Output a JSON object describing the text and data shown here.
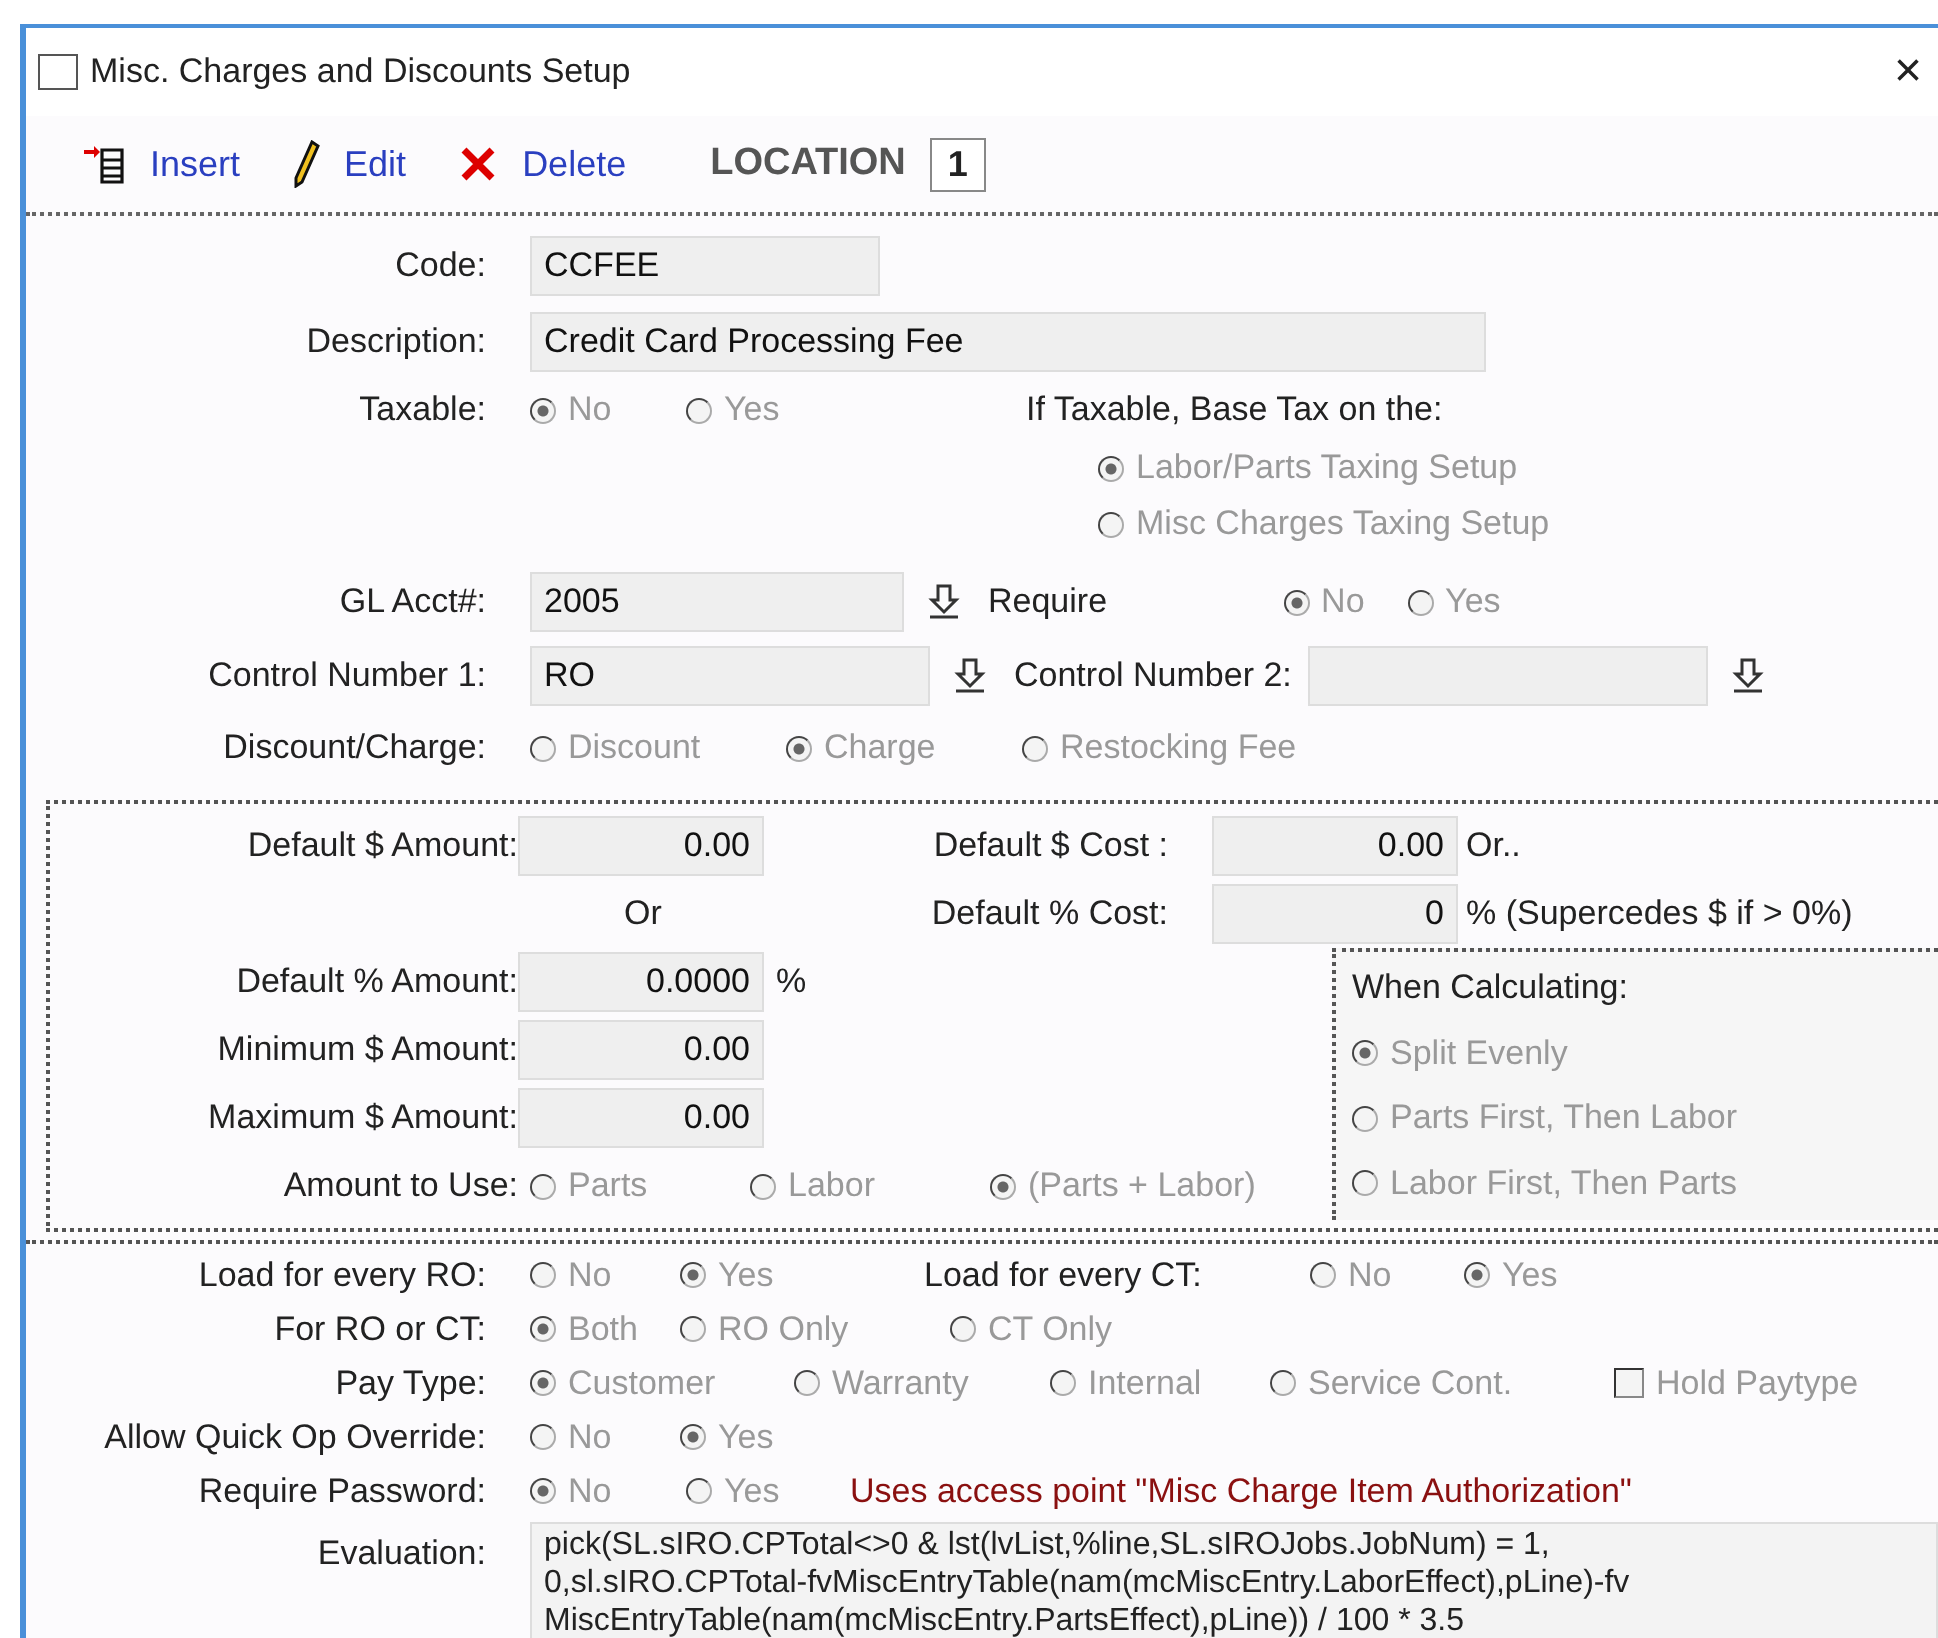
{
  "window": {
    "title": "Misc. Charges and Discounts Setup",
    "close": "×"
  },
  "toolbar": {
    "buttons": [
      {
        "kind": "insert",
        "label": "Insert"
      },
      {
        "kind": "edit",
        "label": "Edit"
      },
      {
        "kind": "delete",
        "label": "Delete"
      }
    ],
    "location_label": "LOCATION",
    "location_value": "1"
  },
  "general": {
    "code": {
      "label": "Code:",
      "value": "CCFEE"
    },
    "description": {
      "label": "Description:",
      "value": "Credit Card Processing Fee"
    },
    "taxable": {
      "label": "Taxable:",
      "options": [
        {
          "label": "No",
          "selected": true
        },
        {
          "label": "Yes",
          "selected": false
        }
      ]
    },
    "tax_base": {
      "label": "If Taxable, Base Tax on the:",
      "options": [
        {
          "label": "Labor/Parts  Taxing Setup",
          "selected": true
        },
        {
          "label": "Misc Charges Taxing Setup",
          "selected": false
        }
      ]
    },
    "gl_acct": {
      "label": "GL Acct#:",
      "value": "2005"
    },
    "require": {
      "label": "Require",
      "options": [
        {
          "label": "No",
          "selected": true
        },
        {
          "label": "Yes",
          "selected": false
        }
      ]
    },
    "control_number_1": {
      "label": "Control Number 1:",
      "value": "RO"
    },
    "control_number_2": {
      "label": "Control Number 2:"
    },
    "discount_charge": {
      "label": "Discount/Charge:",
      "options": [
        {
          "label": "Discount",
          "selected": false
        },
        {
          "label": "Charge",
          "selected": true
        },
        {
          "label": "Restocking Fee",
          "selected": false
        }
      ]
    }
  },
  "amounts": {
    "default_amount": {
      "label": "Default $ Amount:",
      "value": "0.00"
    },
    "or_text": "Or",
    "default_pct_amount": {
      "label": "Default % Amount:",
      "value": "0.0000",
      "suffix": "%"
    },
    "minimum_amount": {
      "label": "Minimum $ Amount:",
      "value": "0.00"
    },
    "maximum_amount": {
      "label": "Maximum $ Amount:",
      "value": "0.00"
    },
    "amount_to_use": {
      "label": "Amount to Use:",
      "options": [
        {
          "label": "Parts",
          "selected": false
        },
        {
          "label": "Labor",
          "selected": false
        },
        {
          "label": "(Parts + Labor)",
          "selected": true
        }
      ]
    },
    "default_cost": {
      "label": "Default $ Cost :",
      "value": "0.00",
      "suffix": "Or.."
    },
    "default_pct_cost": {
      "label": "Default % Cost:",
      "value": "0",
      "suffix": "% (Supercedes $ if > 0%)"
    },
    "when_calculating": {
      "label": "When Calculating:",
      "options": [
        {
          "label": "Split Evenly",
          "selected": true
        },
        {
          "label": "Parts First, Then Labor",
          "selected": false
        },
        {
          "label": "Labor First, Then Parts",
          "selected": false
        }
      ]
    }
  },
  "options": {
    "load_ro": {
      "label": "Load for every RO:",
      "options": [
        {
          "label": "No",
          "selected": false
        },
        {
          "label": "Yes",
          "selected": true
        }
      ]
    },
    "load_ct": {
      "label": "Load for every CT:",
      "options": [
        {
          "label": "No",
          "selected": false
        },
        {
          "label": "Yes",
          "selected": true
        }
      ]
    },
    "for_ro_ct": {
      "label": "For RO or CT:",
      "options": [
        {
          "label": "Both",
          "selected": true
        },
        {
          "label": "RO Only",
          "selected": false
        },
        {
          "label": "CT Only",
          "selected": false
        }
      ]
    },
    "pay_type": {
      "label": "Pay Type:",
      "options": [
        {
          "label": "Customer",
          "selected": true
        },
        {
          "label": "Warranty",
          "selected": false
        },
        {
          "label": "Internal",
          "selected": false
        },
        {
          "label": "Service Cont.",
          "selected": false
        }
      ]
    },
    "hold_paytype": {
      "label": "Hold Paytype",
      "checked": false
    },
    "quick_op": {
      "label": "Allow Quick Op Override:",
      "options": [
        {
          "label": "No",
          "selected": false
        },
        {
          "label": "Yes",
          "selected": true
        }
      ]
    },
    "require_password": {
      "label": "Require Password:",
      "options": [
        {
          "label": "No",
          "selected": true
        },
        {
          "label": "Yes",
          "selected": false
        }
      ],
      "note": "Uses access point \"Misc Charge Item Authorization\""
    },
    "evaluation": {
      "label": "Evaluation:",
      "lines": [
        "pick(SL.sIRO.CPTotal<>0 & lst(lvList,%line,SL.sIROJobs.JobNum) = 1,",
        "0,sl.sIRO.CPTotal-fvMiscEntryTable(nam(mcMiscEntry.LaborEffect),pLine)-fv",
        "MiscEntryTable(nam(mcMiscEntry.PartsEffect),pLine)) / 100 * 3.5"
      ]
    }
  }
}
